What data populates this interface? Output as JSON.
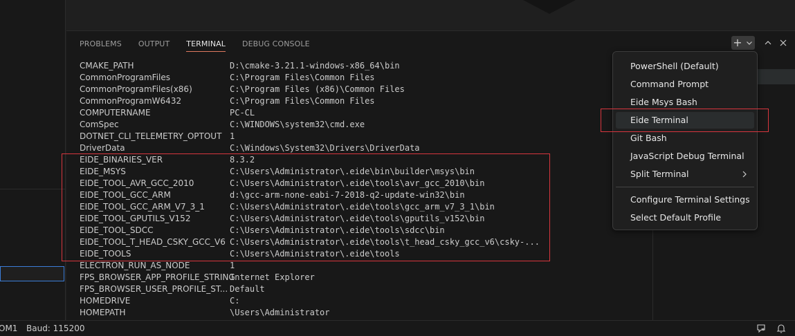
{
  "panel": {
    "tabs": [
      {
        "label": "PROBLEMS",
        "active": false
      },
      {
        "label": "OUTPUT",
        "active": false
      },
      {
        "label": "TERMINAL",
        "active": true
      },
      {
        "label": "DEBUG CONSOLE",
        "active": false
      }
    ],
    "actions": {
      "new_terminal_icon": "plus-icon",
      "dropdown_icon": "chevron-down-icon",
      "maximize_icon": "chevron-up-icon",
      "close_icon": "close-icon"
    }
  },
  "terminal": {
    "rows": [
      {
        "key": "CMAKE_PATH",
        "value": "D:\\cmake-3.21.1-windows-x86_64\\bin"
      },
      {
        "key": "CommonProgramFiles",
        "value": "C:\\Program Files\\Common Files"
      },
      {
        "key": "CommonProgramFiles(x86)",
        "value": "C:\\Program Files (x86)\\Common Files"
      },
      {
        "key": "CommonProgramW6432",
        "value": "C:\\Program Files\\Common Files"
      },
      {
        "key": "COMPUTERNAME",
        "value": "PC-CL"
      },
      {
        "key": "ComSpec",
        "value": "C:\\WINDOWS\\system32\\cmd.exe"
      },
      {
        "key": "DOTNET_CLI_TELEMETRY_OPTOUT",
        "value": "1"
      },
      {
        "key": "DriverData",
        "value": "C:\\Windows\\System32\\Drivers\\DriverData"
      },
      {
        "key": "EIDE_BINARIES_VER",
        "value": "8.3.2"
      },
      {
        "key": "EIDE_MSYS",
        "value": "C:\\Users\\Administrator\\.eide\\bin\\builder\\msys\\bin"
      },
      {
        "key": "EIDE_TOOL_AVR_GCC_2010",
        "value": "C:\\Users\\Administrator\\.eide\\tools\\avr_gcc_2010\\bin"
      },
      {
        "key": "EIDE_TOOL_GCC_ARM",
        "value": "d:\\gcc-arm-none-eabi-7-2018-q2-update-win32\\bin"
      },
      {
        "key": "EIDE_TOOL_GCC_ARM_V7_3_1",
        "value": "C:\\Users\\Administrator\\.eide\\tools\\gcc_arm_v7_3_1\\bin"
      },
      {
        "key": "EIDE_TOOL_GPUTILS_V152",
        "value": "C:\\Users\\Administrator\\.eide\\tools\\gputils_v152\\bin"
      },
      {
        "key": "EIDE_TOOL_SDCC",
        "value": "C:\\Users\\Administrator\\.eide\\tools\\sdcc\\bin"
      },
      {
        "key": "EIDE_TOOL_T_HEAD_CSKY_GCC_V6",
        "value": "C:\\Users\\Administrator\\.eide\\tools\\t_head_csky_gcc_v6\\csky-..."
      },
      {
        "key": "EIDE_TOOLS",
        "value": "C:\\Users\\Administrator\\.eide\\tools"
      },
      {
        "key": "ELECTRON_RUN_AS_NODE",
        "value": "1"
      },
      {
        "key": "FPS_BROWSER_APP_PROFILE_STRING",
        "value": "Internet Explorer"
      },
      {
        "key": "FPS_BROWSER_USER_PROFILE_ST...",
        "value": "Default"
      },
      {
        "key": "HOMEDRIVE",
        "value": "C:"
      },
      {
        "key": "HOMEPATH",
        "value": "\\Users\\Administrator"
      }
    ]
  },
  "menu": {
    "group1": [
      {
        "label": "PowerShell (Default)"
      },
      {
        "label": "Command Prompt"
      },
      {
        "label": "Eide Msys Bash"
      },
      {
        "label": "Eide Terminal",
        "highlighted": true
      },
      {
        "label": "Git Bash"
      },
      {
        "label": "JavaScript Debug Terminal"
      },
      {
        "label": "Split Terminal",
        "submenu": true
      }
    ],
    "group2": [
      {
        "label": "Configure Terminal Settings"
      },
      {
        "label": "Select Default Profile"
      }
    ]
  },
  "statusbar": {
    "port": "OM1",
    "baud": "Baud: 115200",
    "icons": [
      "remote-feedback-icon",
      "bell-icon"
    ]
  },
  "colors": {
    "highlight_border": "#d9363e",
    "active_tab_underline": "#e07a5f"
  }
}
